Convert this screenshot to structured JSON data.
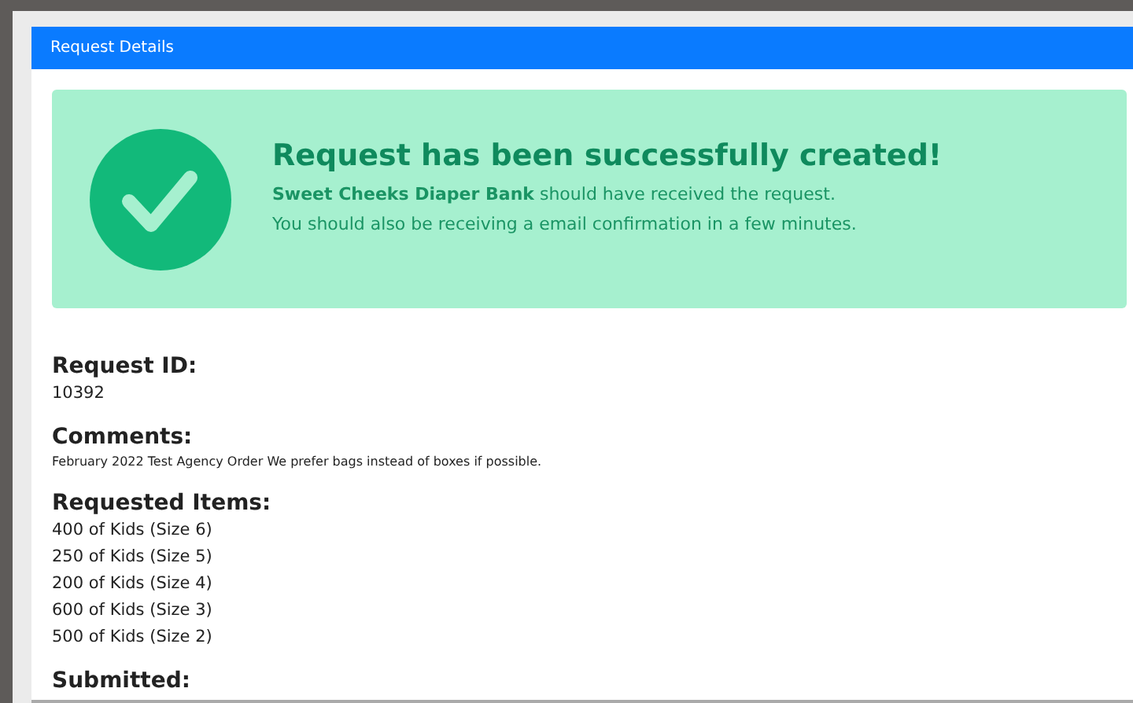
{
  "panel": {
    "title": "Request Details"
  },
  "alert": {
    "title": "Request has been successfully created!",
    "message": "**Sweet Cheeks Diaper Bank** should have received the request.",
    "note": "You should also be receiving a email confirmation in a few minutes."
  },
  "sections": [
    {
      "heading": "Request ID:",
      "kind": "value",
      "lines": [
        "10392"
      ]
    },
    {
      "heading": "Comments:",
      "kind": "small",
      "lines": [
        "February 2022 Test Agency Order We prefer bags instead of boxes if possible."
      ]
    },
    {
      "heading": "Requested Items:",
      "kind": "value",
      "lines": [
        "400 of Kids (Size 6)",
        "250 of Kids (Size 5)",
        "200 of Kids (Size 4)",
        "600 of Kids (Size 3)",
        "500 of Kids (Size 2)"
      ]
    },
    {
      "heading": "Submitted:"
    }
  ]
}
